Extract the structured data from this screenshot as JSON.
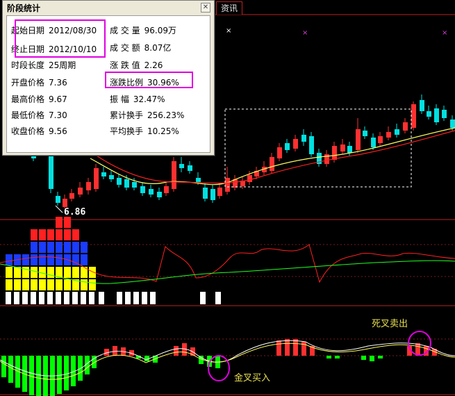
{
  "tabs": {
    "info": "资讯"
  },
  "chart": {
    "low_label": "6.86"
  },
  "annotations": {
    "death_cross": "死叉卖出",
    "golden_cross": "金叉买入"
  },
  "dialog": {
    "title": "阶段统计",
    "close_icon": "close-icon",
    "left": [
      {
        "label": "起始日期",
        "value": "2012/08/30"
      },
      {
        "label": "终止日期",
        "value": "2012/10/10"
      },
      {
        "label": "时段长度",
        "value": "25周期"
      },
      {
        "label": "开盘价格",
        "value": "7.36"
      },
      {
        "label": "最高价格",
        "value": "9.67"
      },
      {
        "label": "最低价格",
        "value": "7.30"
      },
      {
        "label": "收盘价格",
        "value": "9.56"
      }
    ],
    "right": [
      {
        "label": "成 交 量",
        "value": "96.09万"
      },
      {
        "label": "成 交 额",
        "value": "8.07亿"
      },
      {
        "label": "涨 跌 值",
        "value": "2.26"
      },
      {
        "label": "涨跌比例",
        "value": "30.96%"
      },
      {
        "label": "振    幅",
        "value": "32.47%"
      },
      {
        "label": "累计换手",
        "value": "256.23%"
      },
      {
        "label": "平均换手",
        "value": "10.25%"
      }
    ]
  },
  "colors": {
    "up": "#ff3030",
    "down": "#00e0e0",
    "ma_short": "#ffff60",
    "ma_long": "#ff2020",
    "highlight": "#e000e0",
    "volume_green": "#00ff00"
  }
}
